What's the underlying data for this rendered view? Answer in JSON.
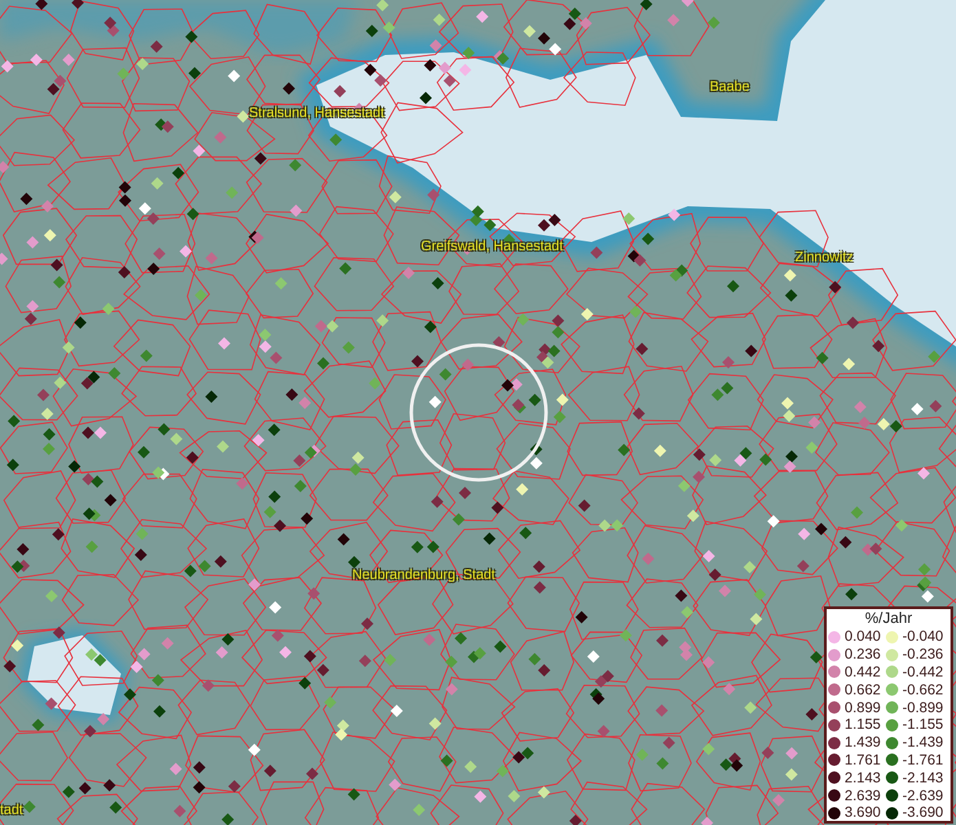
{
  "map": {
    "places": [
      {
        "name": "Stralsund, Hansestadt"
      },
      {
        "name": "Baabe"
      },
      {
        "name": "Greifswald, Hansestadt"
      },
      {
        "name": "Zinnowitz"
      },
      {
        "name": "Neubrandenburg, Stadt"
      },
      {
        "name": "tadt"
      }
    ]
  },
  "legend": {
    "title": "%/Jahr",
    "columns": [
      [
        {
          "value": "0.040",
          "color": "#f4b6e6"
        },
        {
          "value": "0.236",
          "color": "#e39ccc"
        },
        {
          "value": "0.442",
          "color": "#d283aa"
        },
        {
          "value": "0.662",
          "color": "#c06a8c"
        },
        {
          "value": "0.899",
          "color": "#a8506e"
        },
        {
          "value": "1.155",
          "color": "#94405a"
        },
        {
          "value": "1.439",
          "color": "#7c2c44"
        },
        {
          "value": "1.761",
          "color": "#661c30"
        },
        {
          "value": "2.143",
          "color": "#4e1020"
        },
        {
          "value": "2.639",
          "color": "#380814"
        },
        {
          "value": "3.690",
          "color": "#220408"
        }
      ],
      [
        {
          "value": "-0.040",
          "color": "#eef5b0"
        },
        {
          "value": "-0.236",
          "color": "#cfe8a0"
        },
        {
          "value": "-0.442",
          "color": "#aed88a"
        },
        {
          "value": "-0.662",
          "color": "#8cc870"
        },
        {
          "value": "-0.899",
          "color": "#70b458"
        },
        {
          "value": "-1.155",
          "color": "#58a040"
        },
        {
          "value": "-1.439",
          "color": "#3e8830"
        },
        {
          "value": "-1.761",
          "color": "#2a7020"
        },
        {
          "value": "-2.143",
          "color": "#185814"
        },
        {
          "value": "-2.639",
          "color": "#0c400c"
        },
        {
          "value": "-3.690",
          "color": "#062806"
        }
      ]
    ]
  }
}
